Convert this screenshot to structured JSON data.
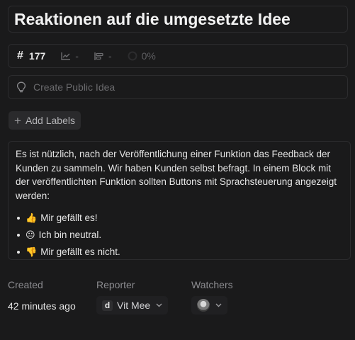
{
  "issue": {
    "title": "Reaktionen auf die umgesetzte Idee",
    "id_symbol": "#",
    "number": "177",
    "trend_value": "-",
    "priority_value": "-",
    "progress": "0%"
  },
  "idea": {
    "placeholder": "Create Public Idea"
  },
  "labels": {
    "add_label": "Add Labels"
  },
  "description": {
    "paragraph": "Es ist nützlich, nach der Veröffentlichung einer Funktion das Feedback der Kunden zu sammeln. Wir haben Kunden selbst befragt. In einem Block mit der veröffentlichten Funktion sollten Buttons mit Sprachsteuerung angezeigt werden:",
    "items": [
      {
        "emoji": "👍",
        "text": "Mir gefällt es!"
      },
      {
        "emoji": "😐",
        "text": "Ich bin neutral."
      },
      {
        "emoji": "👎",
        "text": "Mir gefällt es nicht."
      }
    ]
  },
  "details": {
    "created_label": "Created",
    "created_value": "42 minutes ago",
    "reporter_label": "Reporter",
    "reporter_initial": "d",
    "reporter_name": "Vit Mee",
    "watchers_label": "Watchers"
  },
  "icons": {
    "trend": "chart-line-icon",
    "priority": "bar-align-icon",
    "progress": "progress-circle-icon",
    "idea": "lightbulb-icon",
    "chevron": "chevron-down-icon"
  },
  "colors": {
    "background": "#1a1a1b",
    "border": "#2c2c2e",
    "text": "#e8e8e8",
    "muted": "#6d6d70"
  }
}
